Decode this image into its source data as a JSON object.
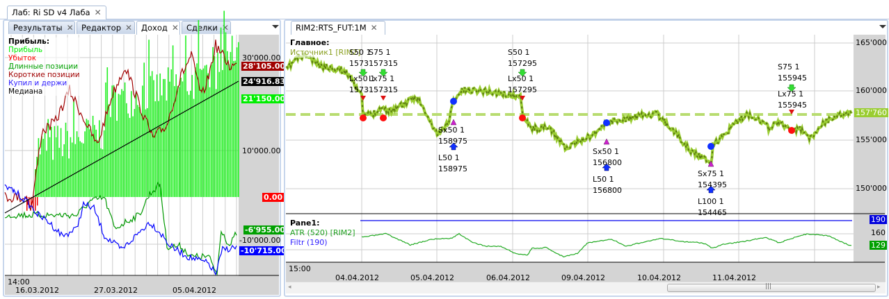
{
  "window_tab": "Лаб: Ri SD v4 Лаба",
  "left": {
    "tabs": [
      {
        "label": "Результаты"
      },
      {
        "label": "Редактор"
      },
      {
        "label": "Доход"
      },
      {
        "label": "Сделки"
      }
    ],
    "legend": {
      "title": "Прибыль:",
      "items": [
        {
          "label": "Прибыль",
          "color": "#00ee00"
        },
        {
          "label": "Убыток",
          "color": "#ff0000"
        },
        {
          "label": "Длинные позиции",
          "color": "#00a000"
        },
        {
          "label": "Короткие позиции",
          "color": "#a00000"
        },
        {
          "label": "Купил и держи",
          "color": "#0000ff"
        },
        {
          "label": "Медиана",
          "color": "#000000"
        }
      ]
    },
    "axis": {
      "t30000": "30'000.00",
      "t10000": "10'000.00",
      "t_10000": "-10'000.00"
    },
    "tags": {
      "short": "28'105.00",
      "median": "24'916.83",
      "profit": "21'150.00",
      "loss": "0.00",
      "long": "-6'955.00",
      "buyhold": "-10'715.00"
    },
    "time": {
      "time": "14:00",
      "dates": [
        "16.03.2012",
        "27.03.2012",
        "05.04.2012"
      ]
    }
  },
  "right": {
    "tab": "RIM2:RTS_FUT:1M",
    "main": {
      "title": "Главное:",
      "source": "Источник1 [RIM2]",
      "price_tag": "157'760",
      "axis": [
        "165'000",
        "160'000",
        "155'000",
        "150'000"
      ]
    },
    "trades": [
      {
        "label": "S50 1\n1573"
      },
      {
        "label": "S75 1\n157315"
      },
      {
        "label": "Lx50 1\n1573"
      },
      {
        "label": "Lx75 1\n157315"
      },
      {
        "label": "S50 1\n157295"
      },
      {
        "label": "Lx50 1\n157295"
      },
      {
        "label": "Sx50 1\n158975"
      },
      {
        "label": "L50 1\n158975"
      },
      {
        "label": "Sx50 1\n156800"
      },
      {
        "label": "L50 1\n156800"
      },
      {
        "label": "Sx75 1\n154395"
      },
      {
        "label": "L100 1\n154465"
      },
      {
        "label": "S75 1\n155945"
      },
      {
        "label": "Lx75 1\n155945"
      }
    ],
    "pane1": {
      "title": "Pane1:",
      "atr": "ATR (520) [RIM2]",
      "filtr": "Filtr (190)",
      "axis": [
        "160"
      ],
      "filtr_tag": "190",
      "atr_tag": "129"
    },
    "time": {
      "time": "15:00",
      "dates": [
        "04.04.2012",
        "05.04.2012",
        "06.04.2012",
        "09.04.2012",
        "10.04.2012",
        "11.04.2012"
      ]
    }
  }
}
